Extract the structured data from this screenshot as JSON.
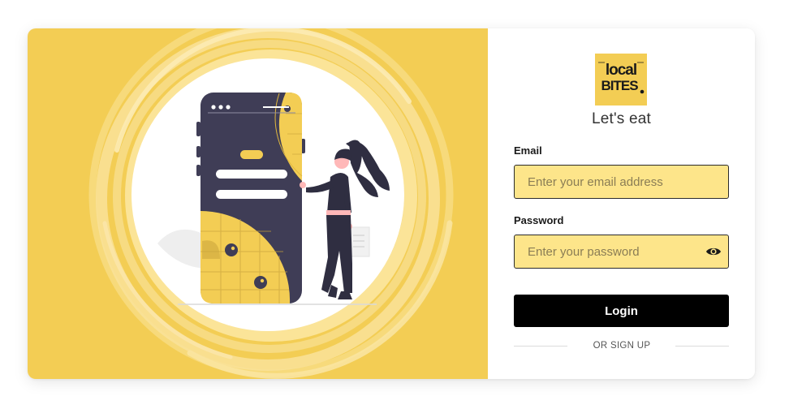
{
  "brand": {
    "logo_line1": "local",
    "logo_line2": "BITES",
    "tagline": "Let's eat",
    "accent_color": "#f3cd54"
  },
  "form": {
    "email_label": "Email",
    "email_placeholder": "Enter your email address",
    "email_value": "",
    "password_label": "Password",
    "password_placeholder": "Enter your password",
    "password_value": "",
    "password_toggle_icon": "eye-icon",
    "login_label": "Login",
    "signup_label": "OR SIGN UP"
  },
  "illustration": {
    "icon": "phone-with-woman-illustration"
  }
}
